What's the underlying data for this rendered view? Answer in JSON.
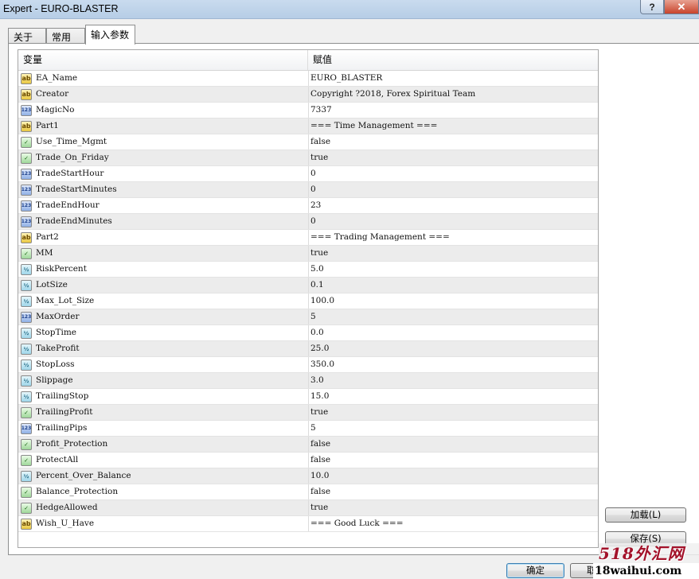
{
  "window": {
    "title": "Expert - EURO-BLASTER",
    "help_label": "?",
    "close_label": "✕"
  },
  "tabs": [
    {
      "label": "关于",
      "active": false
    },
    {
      "label": "常用",
      "active": false
    },
    {
      "label": "输入参数",
      "active": true
    }
  ],
  "grid": {
    "columns": [
      "变量",
      "赋值"
    ],
    "rows": [
      {
        "icon": "ab",
        "name": "EA_Name",
        "value": "EURO_BLASTER"
      },
      {
        "icon": "ab",
        "name": "Creator",
        "value": "Copyright ?2018, Forex Spiritual Team"
      },
      {
        "icon": "123",
        "name": "MagicNo",
        "value": "7337"
      },
      {
        "icon": "ab",
        "name": "Part1",
        "value": "=== Time Management ==="
      },
      {
        "icon": "bool",
        "name": "Use_Time_Mgmt",
        "value": "false"
      },
      {
        "icon": "bool",
        "name": "Trade_On_Friday",
        "value": "true"
      },
      {
        "icon": "123",
        "name": "TradeStartHour",
        "value": "0"
      },
      {
        "icon": "123",
        "name": "TradeStartMinutes",
        "value": "0"
      },
      {
        "icon": "123",
        "name": "TradeEndHour",
        "value": "23"
      },
      {
        "icon": "123",
        "name": "TradeEndMinutes",
        "value": "0"
      },
      {
        "icon": "ab",
        "name": "Part2",
        "value": "=== Trading Management ==="
      },
      {
        "icon": "bool",
        "name": "MM",
        "value": "true"
      },
      {
        "icon": "dbl",
        "name": "RiskPercent",
        "value": "5.0"
      },
      {
        "icon": "dbl",
        "name": "LotSize",
        "value": "0.1"
      },
      {
        "icon": "dbl",
        "name": "Max_Lot_Size",
        "value": "100.0"
      },
      {
        "icon": "123",
        "name": "MaxOrder",
        "value": "5"
      },
      {
        "icon": "dbl",
        "name": "StopTime",
        "value": "0.0"
      },
      {
        "icon": "dbl",
        "name": "TakeProfit",
        "value": "25.0"
      },
      {
        "icon": "dbl",
        "name": "StopLoss",
        "value": "350.0"
      },
      {
        "icon": "dbl",
        "name": "Slippage",
        "value": "3.0"
      },
      {
        "icon": "dbl",
        "name": "TrailingStop",
        "value": "15.0"
      },
      {
        "icon": "bool",
        "name": "TrailingProfit",
        "value": "true"
      },
      {
        "icon": "123",
        "name": "TrailingPips",
        "value": "5"
      },
      {
        "icon": "bool",
        "name": "Profit_Protection",
        "value": "false"
      },
      {
        "icon": "bool",
        "name": "ProtectAll",
        "value": "false"
      },
      {
        "icon": "dbl",
        "name": "Percent_Over_Balance",
        "value": "10.0"
      },
      {
        "icon": "bool",
        "name": "Balance_Protection",
        "value": "false"
      },
      {
        "icon": "bool",
        "name": "HedgeAllowed",
        "value": "true"
      },
      {
        "icon": "ab",
        "name": "Wish_U_Have",
        "value": "=== Good Luck ==="
      }
    ]
  },
  "icon_glyphs": {
    "ab": "ab",
    "123": "123",
    "bool": "✓",
    "dbl": "½"
  },
  "buttons": {
    "load": "加载(L)",
    "save": "保存(S)",
    "ok": "确定",
    "cancel": "取消"
  },
  "watermark": {
    "brand": "518外汇网",
    "url": "18waihui.com"
  }
}
